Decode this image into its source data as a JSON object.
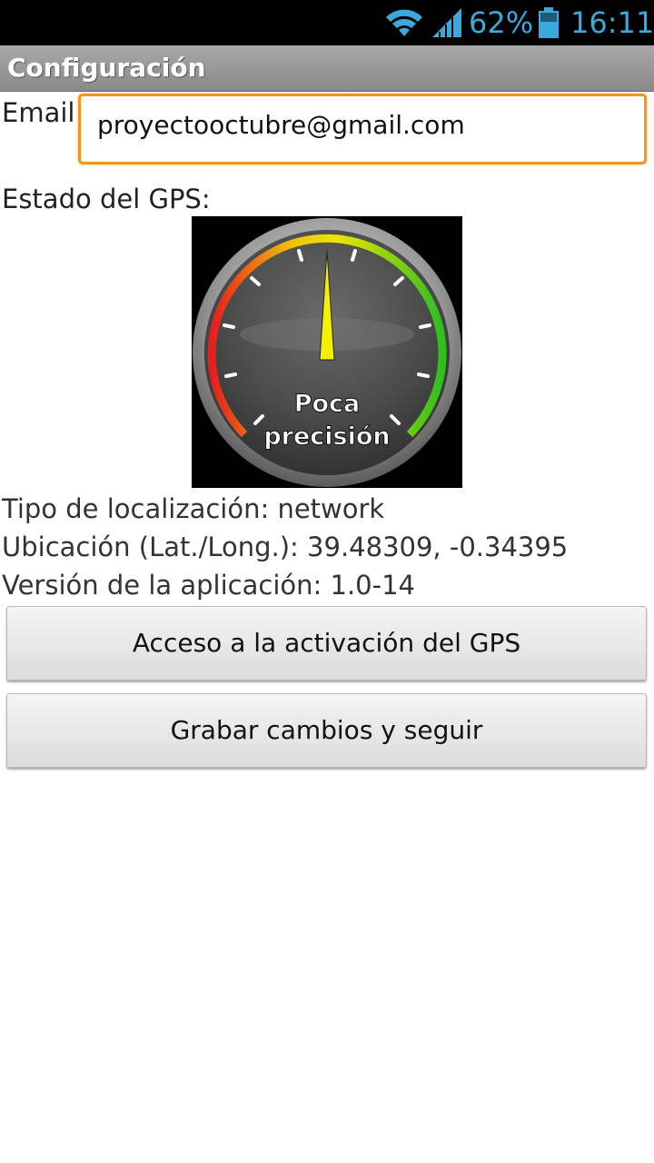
{
  "status_bar": {
    "battery_percent": "62%",
    "time": "16:11",
    "icons": [
      "wifi-icon",
      "signal-icon",
      "battery-icon"
    ],
    "accent_color": "#3ba9dc"
  },
  "title_bar": {
    "title": "Configuración"
  },
  "email": {
    "label": "Email",
    "value": "proyectooctubre@gmail.com",
    "focus_color": "#f7941d"
  },
  "gps": {
    "label": "Estado del GPS:",
    "gauge": {
      "icon": "gps-precision-gauge-icon",
      "status_line1": "Poca",
      "status_line2": "precisión"
    }
  },
  "info": {
    "location_type": "Tipo de localización: network",
    "coordinates": "Ubicación (Lat./Long.): 39.48309, -0.34395",
    "app_version": "Versión de la aplicación: 1.0-14"
  },
  "buttons": {
    "gps_activation": "Acceso a la activación del GPS",
    "save_continue": "Grabar cambios y seguir"
  }
}
